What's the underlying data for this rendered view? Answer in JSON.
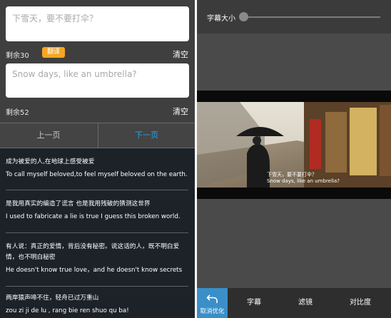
{
  "editor": {
    "source_placeholder": "下雪天，要不要打伞？",
    "source_remaining": "剩余30",
    "translate_label": "翻译",
    "source_clear": "清空",
    "target_text": "Snow days, like an umbrella?",
    "target_remaining": "剩余52",
    "target_clear": "清空"
  },
  "pager": {
    "prev_label": "上一页",
    "next_label": "下一页"
  },
  "phrases": [
    {
      "zh": "成为被爱的人,在地球上感受被爱",
      "en": "To call myself beloved,to feel myself beloved on the earth."
    },
    {
      "zh": "是我用真实的编造了谎言 也是我用残破的猜测这世界",
      "en": "I used to fabricate a lie is true I guess this broken world."
    },
    {
      "zh": "有人说：真正的爱情，背后没有秘密。说这话的人，既不明白爱情，也不明白秘密",
      "en": "He doesn't know true love，and he doesn't know secrets"
    },
    {
      "zh": "两岸猿声啼不住，轻舟已过万重山",
      "en": "zou zi ji de lu , rang bie ren shuo qu ba!"
    }
  ],
  "preview": {
    "subtitle_size_label": "字幕大小",
    "caption_zh": "下雪天，要不要打伞？",
    "caption_en": "Snow days, like an umbrella?"
  },
  "toolbar": {
    "undo_label": "取消优化",
    "subtitle_label": "字幕",
    "filter_label": "滤镜",
    "contrast_label": "对比度"
  },
  "colors": {
    "accent_blue": "#27a2ee",
    "translate_orange": "#f5a623",
    "undo_bg": "#3a8fc8"
  }
}
